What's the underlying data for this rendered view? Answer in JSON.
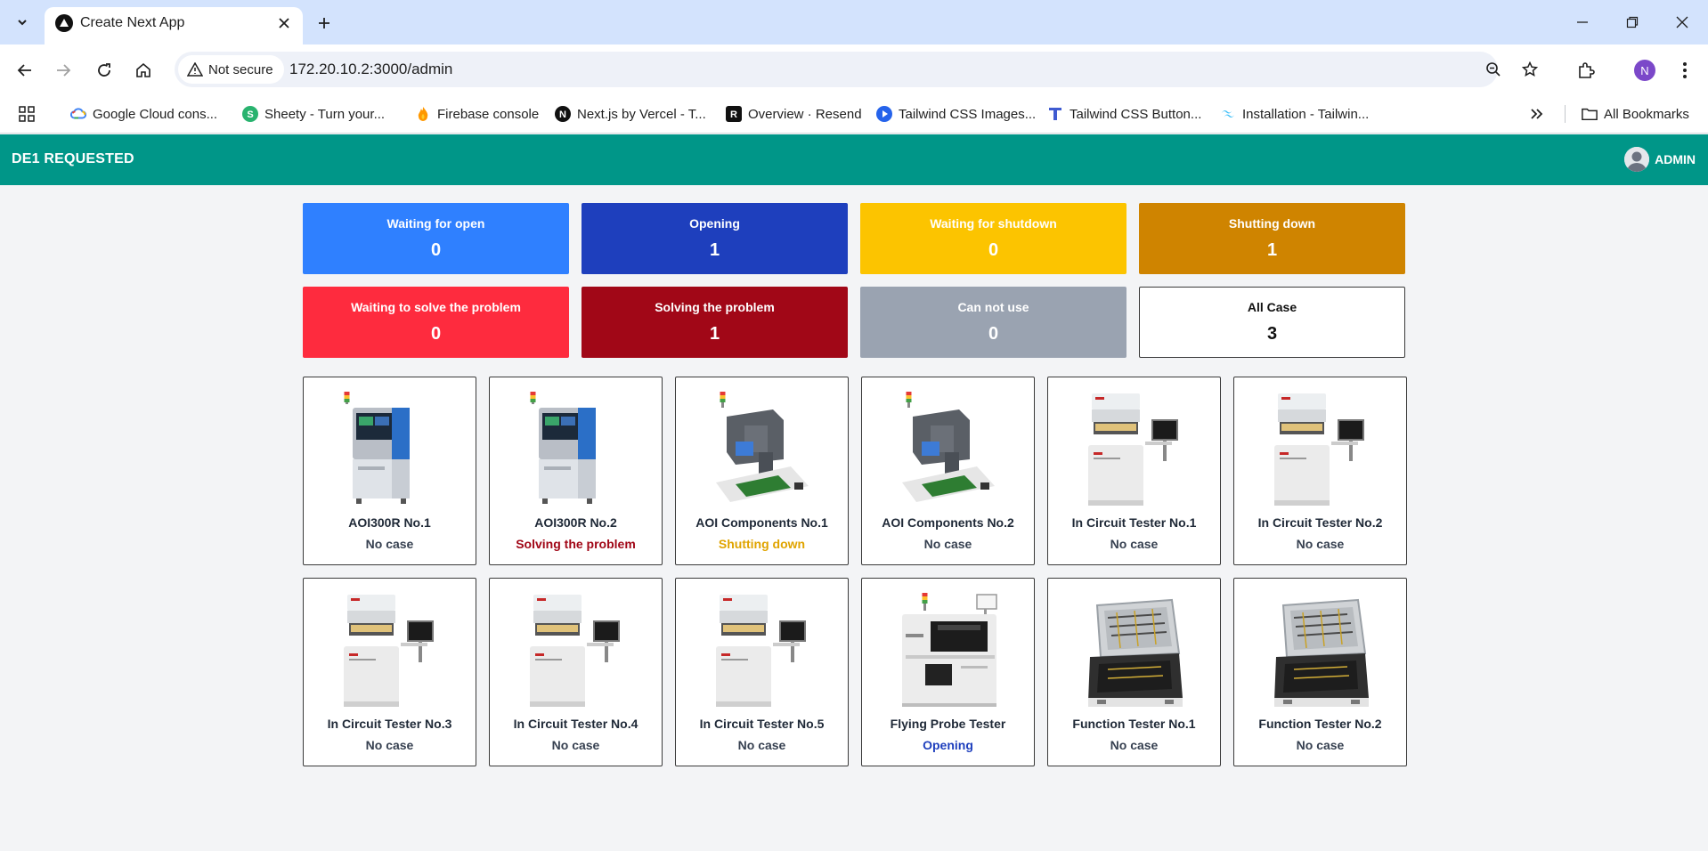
{
  "browser": {
    "tab_title": "Create Next App",
    "secure_label": "Not secure",
    "url": "172.20.10.2:3000/admin",
    "profile_initial": "N",
    "bookmarks": [
      {
        "label": "Google Cloud cons...",
        "icon": "google-cloud-icon"
      },
      {
        "label": "Sheety - Turn your...",
        "icon": "sheety-icon"
      },
      {
        "label": "Firebase console",
        "icon": "firebase-icon"
      },
      {
        "label": "Next.js by Vercel - T...",
        "icon": "nextjs-icon"
      },
      {
        "label": "Overview · Resend",
        "icon": "resend-icon"
      },
      {
        "label": "Tailwind CSS Images...",
        "icon": "play-icon"
      },
      {
        "label": "Tailwind CSS Button...",
        "icon": "tailwind-t-icon"
      },
      {
        "label": "Installation - Tailwin...",
        "icon": "tailwind-icon"
      }
    ],
    "all_bookmarks": "All Bookmarks"
  },
  "app": {
    "title": "DE1 REQUESTED",
    "user": "ADMIN"
  },
  "stats": [
    {
      "label": "Waiting for open",
      "value": "0",
      "bg": "#2f80ff",
      "fg": "#ffffff"
    },
    {
      "label": "Opening",
      "value": "1",
      "bg": "#1e3fbd",
      "fg": "#ffffff"
    },
    {
      "label": "Waiting for shutdown",
      "value": "0",
      "bg": "#fcc400",
      "fg": "#ffffff"
    },
    {
      "label": "Shutting down",
      "value": "1",
      "bg": "#cf8400",
      "fg": "#ffffff"
    },
    {
      "label": "Waiting to solve the problem",
      "value": "0",
      "bg": "#fe2b3e",
      "fg": "#ffffff"
    },
    {
      "label": "Solving the problem",
      "value": "1",
      "bg": "#a10717",
      "fg": "#ffffff"
    },
    {
      "label": "Can not use",
      "value": "0",
      "bg": "#9aa3b1",
      "fg": "#ffffff"
    },
    {
      "label": "All Case",
      "value": "3",
      "bg": "#ffffff",
      "fg": "#111111"
    }
  ],
  "machines": [
    {
      "name": "AOI300R No.1",
      "status": "No case",
      "status_color": "#374151",
      "kind": "aoi"
    },
    {
      "name": "AOI300R No.2",
      "status": "Solving the problem",
      "status_color": "#a10717",
      "kind": "aoi"
    },
    {
      "name": "AOI Components No.1",
      "status": "Shutting down",
      "status_color": "#e0a400",
      "kind": "aoi-comp"
    },
    {
      "name": "AOI Components No.2",
      "status": "No case",
      "status_color": "#374151",
      "kind": "aoi-comp"
    },
    {
      "name": "In Circuit Tester No.1",
      "status": "No case",
      "status_color": "#374151",
      "kind": "ict"
    },
    {
      "name": "In Circuit Tester No.2",
      "status": "No case",
      "status_color": "#374151",
      "kind": "ict"
    },
    {
      "name": "In Circuit Tester No.3",
      "status": "No case",
      "status_color": "#374151",
      "kind": "ict"
    },
    {
      "name": "In Circuit Tester No.4",
      "status": "No case",
      "status_color": "#374151",
      "kind": "ict"
    },
    {
      "name": "In Circuit Tester No.5",
      "status": "No case",
      "status_color": "#374151",
      "kind": "ict"
    },
    {
      "name": "Flying Probe Tester",
      "status": "Opening",
      "status_color": "#1e3fbd",
      "kind": "flying-probe"
    },
    {
      "name": "Function Tester No.1",
      "status": "No case",
      "status_color": "#374151",
      "kind": "function"
    },
    {
      "name": "Function Tester No.2",
      "status": "No case",
      "status_color": "#374151",
      "kind": "function"
    }
  ]
}
